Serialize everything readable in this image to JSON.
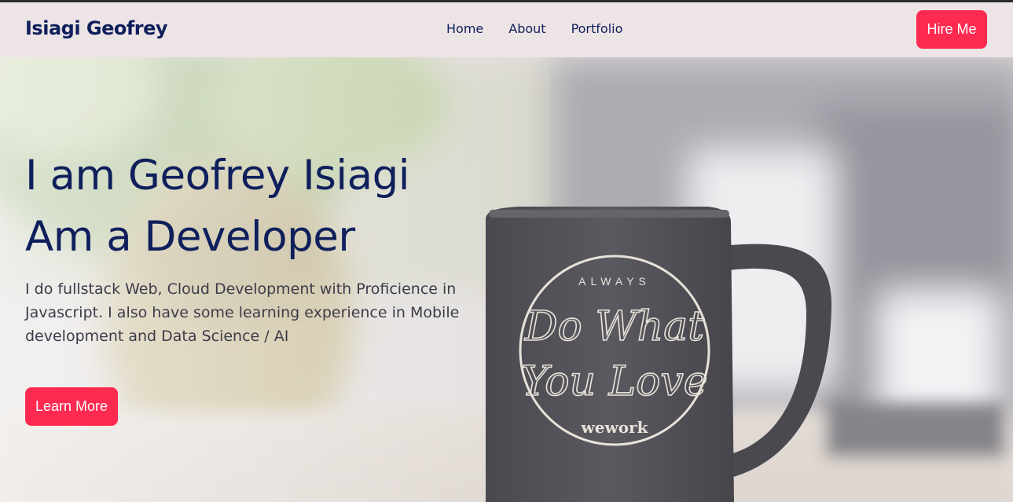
{
  "nav": {
    "brand": "Isiagi Geofrey",
    "links": [
      {
        "label": "Home"
      },
      {
        "label": "About"
      },
      {
        "label": "Portfolio"
      }
    ],
    "cta_label": "Hire Me"
  },
  "hero": {
    "title_line1": "I am Geofrey Isiagi",
    "title_line2": "Am a Developer",
    "description": "I do fullstack Web, Cloud Development with Proficience in Javascript. I also have some learning experience in Mobile development and Data Science / AI",
    "button_label": "Learn More",
    "mug_text": {
      "top": "ALWAYS",
      "line1": "Do What",
      "line2": "You Love",
      "brand": "wework"
    }
  },
  "colors": {
    "accent": "#ff2a50",
    "navy": "#0f1f5c",
    "navbar_bg": "#ede4e6"
  }
}
